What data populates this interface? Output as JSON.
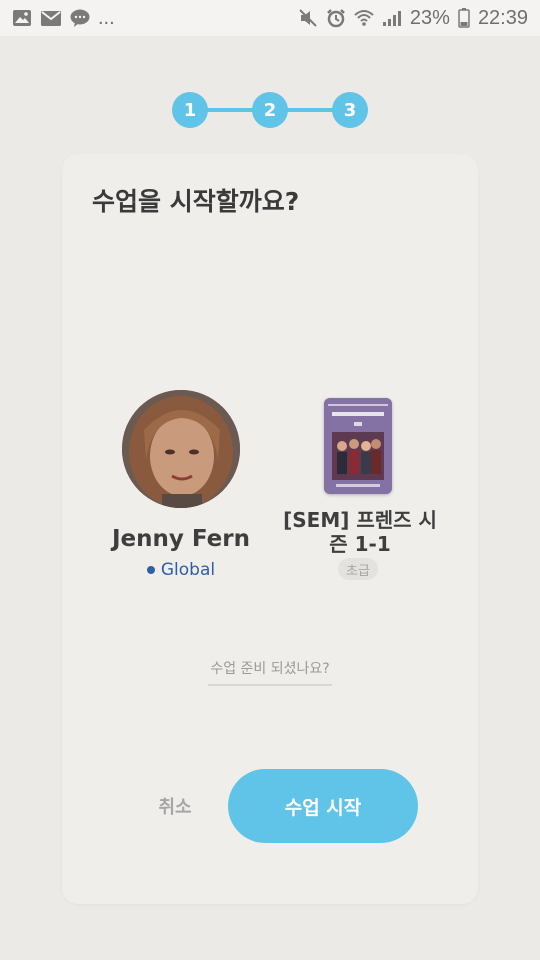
{
  "status_bar": {
    "left_icons": [
      "image-icon",
      "mail-icon",
      "chat-icon"
    ],
    "ellipsis": "...",
    "right_icons": [
      "mute-icon",
      "alarm-icon",
      "wifi-icon",
      "signal-icon"
    ],
    "battery": "23%",
    "battery_icon": "battery-icon",
    "time": "22:39"
  },
  "stepper": {
    "steps": [
      "1",
      "2",
      "3"
    ],
    "color": "#5fc4e7"
  },
  "card": {
    "title": "수업을 시작할까요?",
    "tutor": {
      "name": "Jenny Fern",
      "region": "Global",
      "region_color": "#2f5fa6"
    },
    "material": {
      "title": "[SEM] 프렌즈 시즌 1-1",
      "level": "초급"
    },
    "ready_prompt": "수업 준비 되셨나요?",
    "cancel_label": "취소",
    "start_label": "수업 시작"
  }
}
